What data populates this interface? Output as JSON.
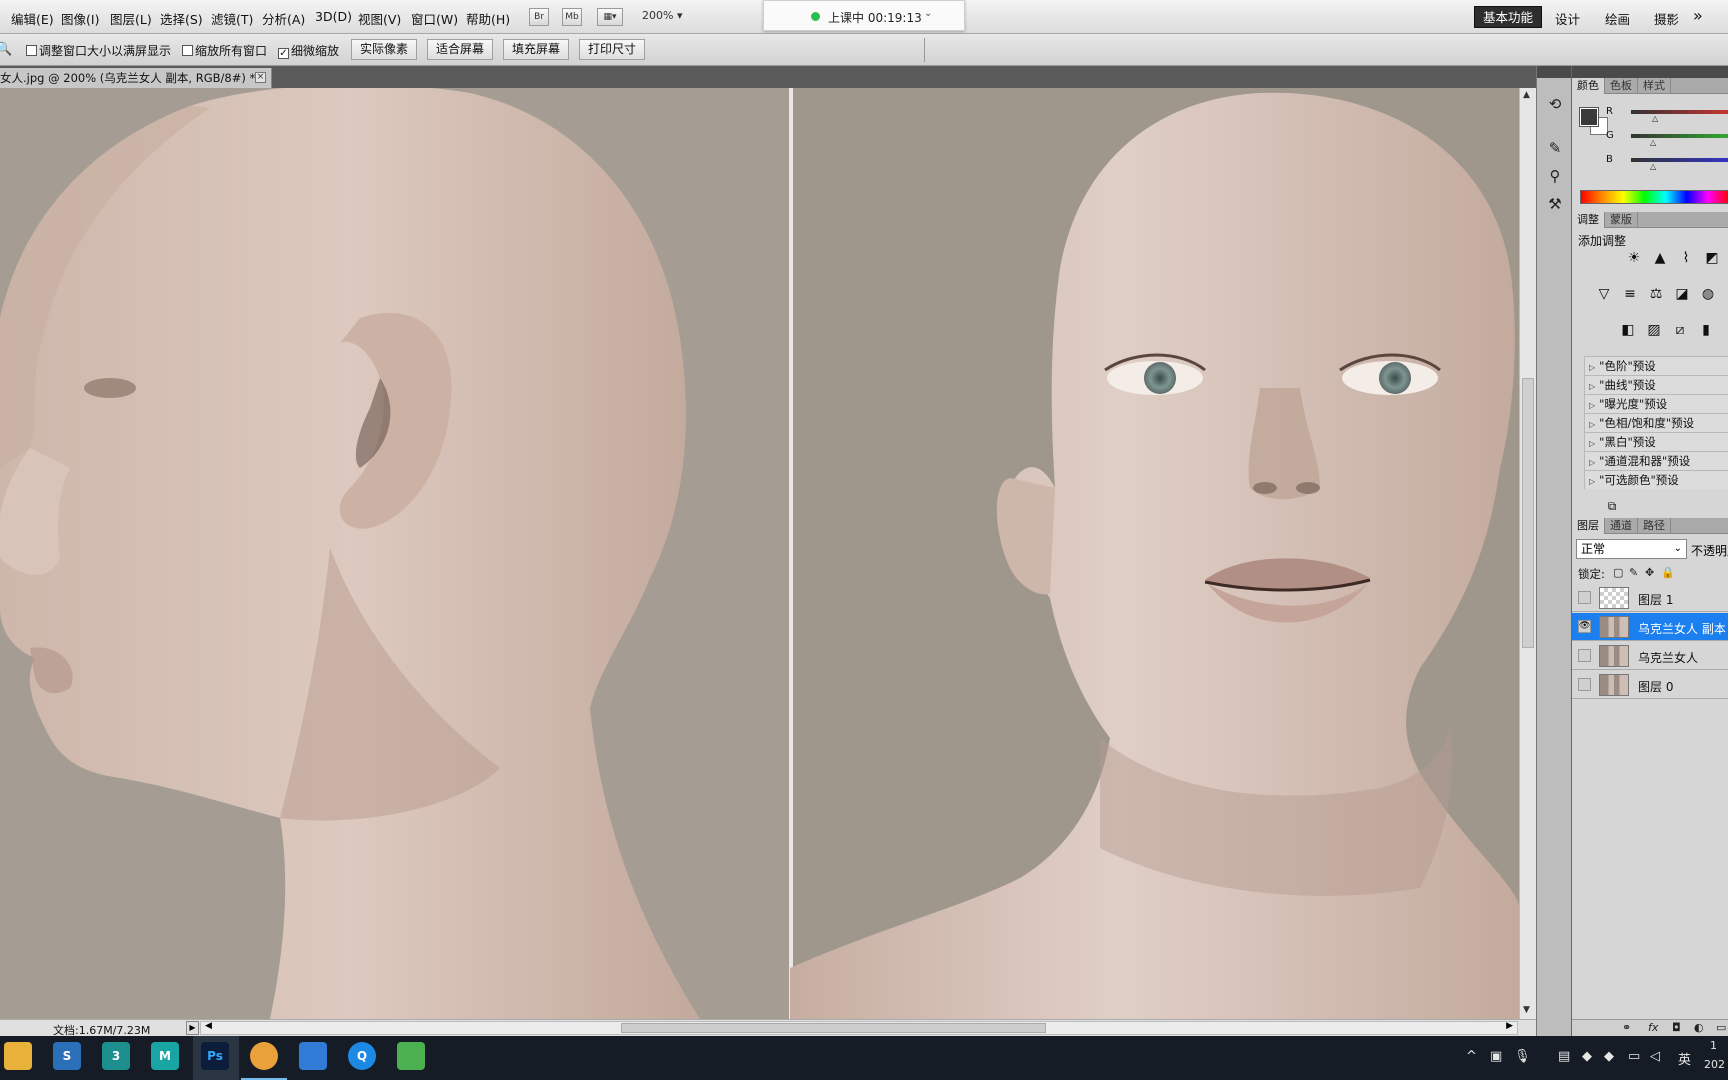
{
  "menubar": {
    "items": [
      "编辑(E)",
      "图像(I)",
      "图层(L)",
      "选择(S)",
      "滤镜(T)",
      "分析(A)",
      "3D(D)",
      "视图(V)",
      "窗口(W)",
      "帮助(H)"
    ],
    "bridge_label": "Br",
    "minibridge_label": "Mb",
    "zoom_level": "200%",
    "timer": "上课中 00:19:13",
    "workspaces": [
      "基本功能",
      "设计",
      "绘画",
      "摄影"
    ],
    "more": "»"
  },
  "options": {
    "checks": [
      {
        "label": "调整窗口大小以满屏显示",
        "checked": false
      },
      {
        "label": "缩放所有窗口",
        "checked": false
      },
      {
        "label": "细微缩放",
        "checked": true
      }
    ],
    "buttons": [
      "实际像素",
      "适合屏幕",
      "填充屏幕",
      "打印尺寸"
    ]
  },
  "document": {
    "tab_title": "女人.jpg @ 200% (乌克兰女人 副本, RGB/8#) *",
    "status": "文档:1.67M/7.23M"
  },
  "panels": {
    "color_tabs": [
      "颜色",
      "色板",
      "样式"
    ],
    "color_sliders": [
      {
        "label": "R",
        "color": "#cc3333",
        "value": 0.24
      },
      {
        "label": "G",
        "color": "#33aa33",
        "value": 0.22
      },
      {
        "label": "B",
        "color": "#3333cc",
        "value": 0.22
      }
    ],
    "foreground_color": "#3a3a3a",
    "background_color": "#ffffff",
    "adjust_tabs": [
      "调整",
      "蒙版"
    ],
    "adjust_title": "添加调整",
    "presets": [
      "\"色阶\"预设",
      "\"曲线\"预设",
      "\"曝光度\"预设",
      "\"色相/饱和度\"预设",
      "\"黑白\"预设",
      "\"通道混和器\"预设",
      "\"可选颜色\"预设"
    ],
    "layer_tabs": [
      "图层",
      "通道",
      "路径"
    ],
    "blend_mode": "正常",
    "opacity_label": "不透明度",
    "lock_label": "锁定:",
    "layers": [
      {
        "name": "图层 1",
        "visible": false,
        "selected": false,
        "thumb": "transparent"
      },
      {
        "name": "乌克兰女人 副本",
        "visible": true,
        "selected": true,
        "thumb": "face"
      },
      {
        "name": "乌克兰女人",
        "visible": false,
        "selected": false,
        "thumb": "face"
      },
      {
        "name": "图层 0",
        "visible": false,
        "selected": false,
        "thumb": "face"
      }
    ]
  },
  "taskbar": {
    "apps": [
      {
        "name": "file-explorer",
        "label": "",
        "color": "#e8b23a"
      },
      {
        "name": "sketchbook",
        "label": "S",
        "color": "#2a6fb8"
      },
      {
        "name": "3ds-max",
        "label": "3",
        "color": "#1d8f8f"
      },
      {
        "name": "maya",
        "label": "M",
        "color": "#1aa5a5"
      },
      {
        "name": "photoshop",
        "label": "Ps",
        "color": "#0b1d3a"
      },
      {
        "name": "chrome",
        "label": "",
        "color": "#e9a23b"
      },
      {
        "name": "app-blue",
        "label": "",
        "color": "#2f7bd6"
      },
      {
        "name": "app-q",
        "label": "Q",
        "color": "#1e88e5"
      },
      {
        "name": "app-green",
        "label": "",
        "color": "#4caf50"
      }
    ],
    "ime": "英",
    "clock_top": "1",
    "clock_bottom": "202"
  }
}
